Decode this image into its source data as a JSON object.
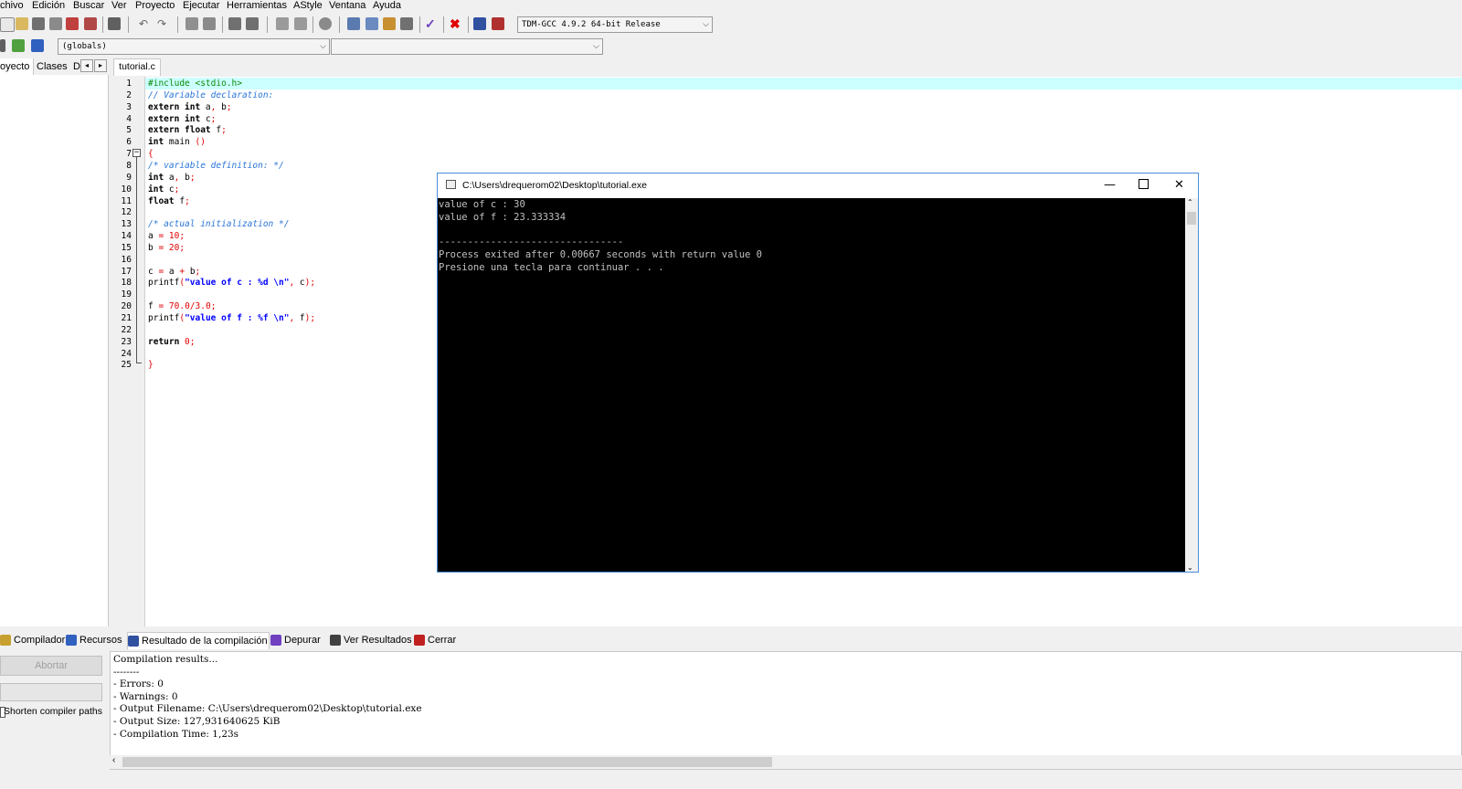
{
  "menu": [
    "chivo",
    "Edición",
    "Buscar",
    "Ver",
    "Proyecto",
    "Ejecutar",
    "Herramientas",
    "AStyle",
    "Ventana",
    "Ayuda"
  ],
  "toolbar": {
    "compiler_select": "TDM-GCC 4.9.2 64-bit Release",
    "globals_select": "(globals)",
    "second_select": ""
  },
  "left_tabs": [
    "oyecto",
    "Clases",
    "D"
  ],
  "editor": {
    "tab": "tutorial.c",
    "lines": [
      {
        "n": "1",
        "segs": [
          [
            "pp",
            "#include <stdio.h>"
          ]
        ]
      },
      {
        "n": "2",
        "segs": [
          [
            "cm",
            "// Variable declaration:"
          ]
        ]
      },
      {
        "n": "3",
        "segs": [
          [
            "k",
            "extern int "
          ],
          [
            "",
            "a"
          ],
          [
            "pu",
            ","
          ],
          [
            "",
            " b"
          ],
          [
            "pu",
            ";"
          ]
        ]
      },
      {
        "n": "4",
        "segs": [
          [
            "k",
            "extern int "
          ],
          [
            "",
            "c"
          ],
          [
            "pu",
            ";"
          ]
        ]
      },
      {
        "n": "5",
        "segs": [
          [
            "k",
            "extern float "
          ],
          [
            "",
            "f"
          ],
          [
            "pu",
            ";"
          ]
        ]
      },
      {
        "n": "6",
        "segs": [
          [
            "k",
            "int "
          ],
          [
            "",
            "main "
          ],
          [
            "pu",
            "()"
          ]
        ]
      },
      {
        "n": "7",
        "segs": [
          [
            "pu",
            "{"
          ]
        ]
      },
      {
        "n": "8",
        "segs": [
          [
            "cm",
            "/* variable definition: */"
          ]
        ]
      },
      {
        "n": "9",
        "segs": [
          [
            "k",
            "int "
          ],
          [
            "",
            "a"
          ],
          [
            "pu",
            ","
          ],
          [
            "",
            " b"
          ],
          [
            "pu",
            ";"
          ]
        ]
      },
      {
        "n": "10",
        "segs": [
          [
            "k",
            "int "
          ],
          [
            "",
            "c"
          ],
          [
            "pu",
            ";"
          ]
        ]
      },
      {
        "n": "11",
        "segs": [
          [
            "k",
            "float "
          ],
          [
            "",
            "f"
          ],
          [
            "pu",
            ";"
          ]
        ]
      },
      {
        "n": "12",
        "segs": []
      },
      {
        "n": "13",
        "segs": [
          [
            "cm",
            "/* actual initialization */"
          ]
        ]
      },
      {
        "n": "14",
        "segs": [
          [
            "",
            "a "
          ],
          [
            "pu",
            "="
          ],
          [
            "nu",
            " 10"
          ],
          [
            "pu",
            ";"
          ]
        ]
      },
      {
        "n": "15",
        "segs": [
          [
            "",
            "b "
          ],
          [
            "pu",
            "="
          ],
          [
            "nu",
            " 20"
          ],
          [
            "pu",
            ";"
          ]
        ]
      },
      {
        "n": "16",
        "segs": []
      },
      {
        "n": "17",
        "segs": [
          [
            "",
            "c "
          ],
          [
            "pu",
            "="
          ],
          [
            "",
            " a "
          ],
          [
            "pu",
            "+"
          ],
          [
            "",
            " b"
          ],
          [
            "pu",
            ";"
          ]
        ]
      },
      {
        "n": "18",
        "segs": [
          [
            "",
            "printf"
          ],
          [
            "pu",
            "("
          ],
          [
            "st",
            "\"value of c : %d \\n\""
          ],
          [
            "pu",
            ","
          ],
          [
            "",
            " c"
          ],
          [
            "pu",
            ");"
          ]
        ]
      },
      {
        "n": "19",
        "segs": []
      },
      {
        "n": "20",
        "segs": [
          [
            "",
            "f "
          ],
          [
            "pu",
            "="
          ],
          [
            "nu",
            " 70.0"
          ],
          [
            "pu",
            "/"
          ],
          [
            "nu",
            "3.0"
          ],
          [
            "pu",
            ";"
          ]
        ]
      },
      {
        "n": "21",
        "segs": [
          [
            "",
            "printf"
          ],
          [
            "pu",
            "("
          ],
          [
            "st",
            "\"value of f : %f \\n\""
          ],
          [
            "pu",
            ","
          ],
          [
            "",
            " f"
          ],
          [
            "pu",
            ");"
          ]
        ]
      },
      {
        "n": "22",
        "segs": []
      },
      {
        "n": "23",
        "segs": [
          [
            "k",
            "return "
          ],
          [
            "nu",
            "0"
          ],
          [
            "pu",
            ";"
          ]
        ]
      },
      {
        "n": "24",
        "segs": []
      },
      {
        "n": "25",
        "segs": [
          [
            "pu",
            "}"
          ]
        ]
      }
    ]
  },
  "console": {
    "title": "C:\\Users\\drequerom02\\Desktop\\tutorial.exe",
    "lines": [
      "value of c : 30",
      "value of f : 23.333334",
      "",
      "--------------------------------",
      "Process exited after 0.00667 seconds with return value 0",
      "Presione una tecla para continuar . . ."
    ]
  },
  "bottom_tabs": [
    {
      "label": "Compilador",
      "icon": "compiler-icon",
      "color": "#c8a030"
    },
    {
      "label": "Recursos",
      "icon": "resources-icon",
      "color": "#3060c0"
    },
    {
      "label": "Resultado de la compilación",
      "icon": "chart-icon",
      "color": "#3050a0"
    },
    {
      "label": "Depurar",
      "icon": "check-icon",
      "color": "#7040c0"
    },
    {
      "label": "Ver Resultados",
      "icon": "view-results-icon",
      "color": "#404040"
    },
    {
      "label": "Cerrar",
      "icon": "close-icon",
      "color": "#c02020"
    }
  ],
  "bottom_left": {
    "abort_label": "Abortar",
    "shorten_label": "Shorten compiler paths"
  },
  "output": [
    "Compilation results...",
    "--------",
    "- Errors: 0",
    "- Warnings: 0",
    "- Output Filename: C:\\Users\\drequerom02\\Desktop\\tutorial.exe",
    "- Output Size: 127,931640625 KiB",
    "- Compilation Time: 1,23s"
  ]
}
